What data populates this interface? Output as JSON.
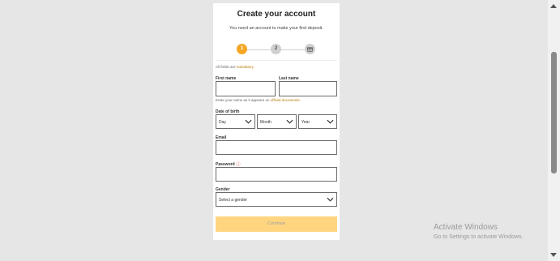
{
  "form": {
    "title": "Create your account",
    "subtitle": "You need an account to make your first deposit.",
    "steps": [
      {
        "label": "1",
        "state": "active"
      },
      {
        "label": "2",
        "state": "inactive"
      },
      {
        "label": "",
        "icon": "gift-icon",
        "state": "inactive"
      }
    ],
    "mandatory_note_prefix": "All fields are ",
    "mandatory_note_accent": "mandatory",
    "first_name_label": "First name",
    "first_name_value": "",
    "last_name_label": "Last name",
    "last_name_value": "",
    "name_hint_prefix": "Enter your name as it appears on ",
    "name_hint_accent": "official documents.",
    "dob_label": "Date of birth",
    "dob_day": "Day",
    "dob_month": "Month",
    "dob_year": "Year",
    "email_label": "Email",
    "email_value": "",
    "password_label": "Password",
    "password_value": "",
    "gender_label": "Gender",
    "gender_value": "Select a gender",
    "continue_label": "Continue"
  },
  "colors": {
    "accent": "#f5a623",
    "button_disabled_bg": "#ffd580",
    "background": "#e6e6e6"
  },
  "watermark": {
    "title": "Activate Windows",
    "subtitle": "Go to Settings to activate Windows."
  }
}
